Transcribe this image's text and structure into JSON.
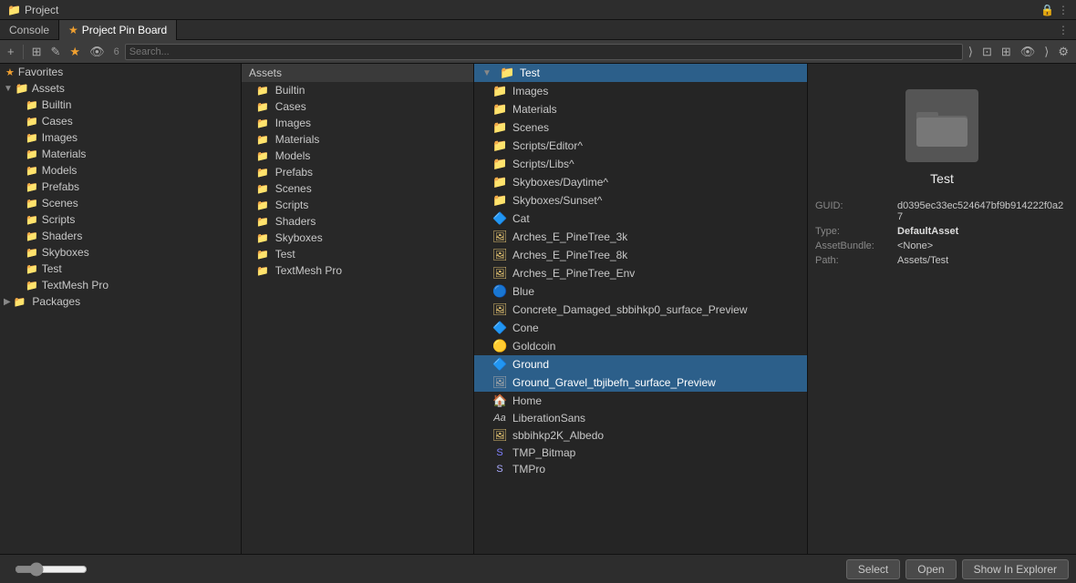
{
  "window": {
    "title": "Project",
    "lock_icon": "🔒",
    "more_icon": "⋮"
  },
  "tabs": [
    {
      "id": "console",
      "label": "Console",
      "active": false
    },
    {
      "id": "project-pin-board",
      "label": "Project Pin Board",
      "active": true
    }
  ],
  "toolbar": {
    "search_placeholder": "Search...",
    "count_label": "6",
    "btn_create": "+",
    "btn_toggle1": "⊞",
    "btn_toggle2": "✎",
    "btn_star": "★",
    "btn_eye": "👁",
    "btn_search_right": "⟩",
    "btn_layout": "⊡"
  },
  "favorites": {
    "header": "Favorites",
    "items": [
      {
        "label": "Assets",
        "depth": 0,
        "expanded": true,
        "type": "folder"
      },
      {
        "label": "Builtin",
        "depth": 1,
        "type": "folder"
      },
      {
        "label": "Cases",
        "depth": 1,
        "type": "folder"
      },
      {
        "label": "Images",
        "depth": 1,
        "type": "folder"
      },
      {
        "label": "Materials",
        "depth": 1,
        "type": "folder"
      },
      {
        "label": "Models",
        "depth": 1,
        "type": "folder"
      },
      {
        "label": "Prefabs",
        "depth": 1,
        "type": "folder"
      },
      {
        "label": "Scenes",
        "depth": 1,
        "type": "folder"
      },
      {
        "label": "Scripts",
        "depth": 1,
        "type": "folder"
      },
      {
        "label": "Shaders",
        "depth": 1,
        "type": "folder"
      },
      {
        "label": "Skyboxes",
        "depth": 1,
        "type": "folder"
      },
      {
        "label": "Test",
        "depth": 1,
        "type": "folder"
      },
      {
        "label": "TextMesh Pro",
        "depth": 1,
        "type": "folder"
      }
    ]
  },
  "assets_panel": {
    "header": "Assets",
    "items": [
      {
        "label": "Builtin",
        "type": "folder"
      },
      {
        "label": "Cases",
        "type": "folder"
      },
      {
        "label": "Images",
        "type": "folder"
      },
      {
        "label": "Materials",
        "type": "folder"
      },
      {
        "label": "Models",
        "type": "folder"
      },
      {
        "label": "Prefabs",
        "type": "folder"
      },
      {
        "label": "Scenes",
        "type": "folder"
      },
      {
        "label": "Scripts",
        "type": "folder"
      },
      {
        "label": "Shaders",
        "type": "folder"
      },
      {
        "label": "Skyboxes",
        "type": "folder"
      },
      {
        "label": "Test",
        "type": "folder"
      },
      {
        "label": "TextMesh Pro",
        "type": "folder"
      }
    ]
  },
  "file_list": {
    "selected_folder": "Test",
    "items": [
      {
        "label": "Test",
        "type": "folder",
        "selected": true,
        "is_header": true
      },
      {
        "label": "Images",
        "type": "folder"
      },
      {
        "label": "Materials",
        "type": "folder"
      },
      {
        "label": "Scenes",
        "type": "folder"
      },
      {
        "label": "Scripts/Editor^",
        "type": "folder"
      },
      {
        "label": "Scripts/Libs^",
        "type": "folder"
      },
      {
        "label": "Skyboxes/Daytime^",
        "type": "folder"
      },
      {
        "label": "Skyboxes/Sunset^",
        "type": "folder"
      },
      {
        "label": "Cat",
        "type": "prefab"
      },
      {
        "label": "Arches_E_PineTree_3k",
        "type": "texture"
      },
      {
        "label": "Arches_E_PineTree_8k",
        "type": "texture"
      },
      {
        "label": "Arches_E_PineTree_Env",
        "type": "texture"
      },
      {
        "label": "Blue",
        "type": "material_blue"
      },
      {
        "label": "Concrete_Damaged_sbbihkp0_surface_Preview",
        "type": "texture"
      },
      {
        "label": "Cone",
        "type": "mesh"
      },
      {
        "label": "Goldcoin",
        "type": "prefab_gold"
      },
      {
        "label": "Ground",
        "type": "mesh",
        "selected": true
      },
      {
        "label": "Ground_Gravel_tbjibefn_surface_Preview",
        "type": "texture_gray",
        "selected": true
      },
      {
        "label": "Home",
        "type": "prefab_home"
      },
      {
        "label": "LiberationSans",
        "type": "font"
      },
      {
        "label": "sbbihkp2K_Albedo",
        "type": "texture2"
      },
      {
        "label": "TMP_Bitmap",
        "type": "tmp"
      },
      {
        "label": "TMPro",
        "type": "tmp2"
      }
    ]
  },
  "inspector": {
    "title": "Test",
    "guid_label": "GUID:",
    "guid_value": "d0395ec33ec524647bf9b914222f0a27",
    "type_label": "Type:",
    "type_value": "DefaultAsset",
    "assetbundle_label": "AssetBundle:",
    "assetbundle_value": "<None>",
    "path_label": "Path:",
    "path_value": "Assets/Test"
  },
  "bottom_bar": {
    "select_label": "Select",
    "open_label": "Open",
    "show_explorer_label": "Show In Explorer"
  }
}
